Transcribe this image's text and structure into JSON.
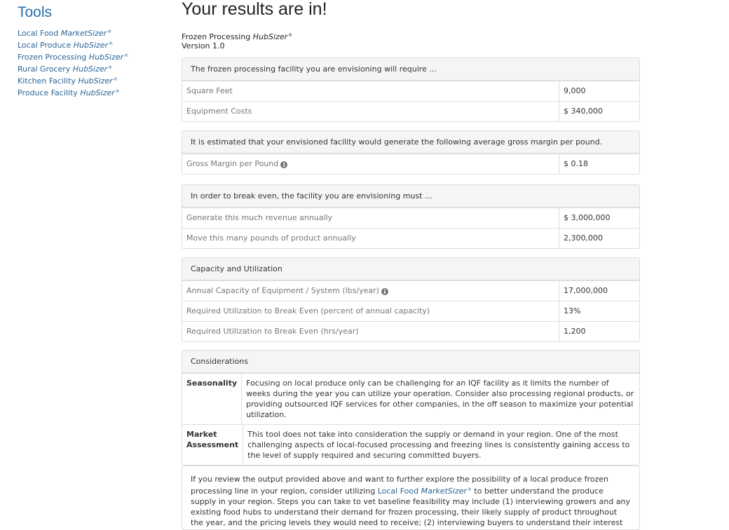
{
  "sidebar": {
    "title": "Tools",
    "links": [
      {
        "plain": "Local Food",
        "italic": "MarketSizer",
        "mark": "®"
      },
      {
        "plain": "Local Produce",
        "italic": "HubSizer",
        "mark": "®"
      },
      {
        "plain": "Frozen Processing",
        "italic": "HubSizer",
        "mark": "®"
      },
      {
        "plain": "Rural Grocery",
        "italic": "HubSizer",
        "mark": "®"
      },
      {
        "plain": "Kitchen Facility",
        "italic": "HubSizer",
        "mark": "®"
      },
      {
        "plain": "Produce Facility",
        "italic": "HubSizer",
        "mark": "®"
      }
    ]
  },
  "main": {
    "title": "Your results are in!",
    "product_plain": "Frozen Processing",
    "product_italic": "HubSizer",
    "product_mark": "®",
    "version": "Version 1.0",
    "requirements": {
      "heading": "The frozen processing facility you are envisioning will require ...",
      "rows": [
        {
          "label": "Square Feet",
          "value": "9,000"
        },
        {
          "label": "Equipment Costs",
          "value": "$ 340,000"
        }
      ]
    },
    "margin": {
      "heading": "It is estimated that your envisioned facility would generate the following average gross margin per pound.",
      "rows": [
        {
          "label": "Gross Margin per Pound",
          "value": "$ 0.18"
        }
      ]
    },
    "breakeven": {
      "heading": "In order to break even, the facility you are envisioning must ...",
      "rows": [
        {
          "label": "Generate this much revenue annually",
          "value": "$ 3,000,000"
        },
        {
          "label": "Move this many pounds of product annually",
          "value": "2,300,000"
        }
      ]
    },
    "capacity": {
      "heading": "Capacity and Utilization",
      "rows": [
        {
          "label": "Annual Capacity of Equipment / System (lbs/year)",
          "value": "17,000,000"
        },
        {
          "label": "Required Utilization to Break Even (percent of annual capacity)",
          "value": "13%"
        },
        {
          "label": "Required Utilization to Break Even (hrs/year)",
          "value": "1,200"
        }
      ]
    },
    "considerations": {
      "heading": "Considerations",
      "rows": [
        {
          "term": "Seasonality",
          "desc": "Focusing on local produce only can be challenging for an IQF facility as it limits the number of weeks during the year you can utilize your operation. Consider also processing regional products, or providing outsourced IQF services for other companies, in the off season to maximize your potential utilization."
        },
        {
          "term": "Market Assessment",
          "desc": "This tool does not take into consideration the supply or demand in your region. One of the most challenging aspects of local-focused processing and freezing lines is consistently gaining access to the level of supply required and securing committed buyers."
        }
      ]
    },
    "final": {
      "text_before": "If you review the output provided above and want to further explore the possibility of a local produce frozen processing line in your region, consider utilizing ",
      "link_plain": "Local Food",
      "link_italic": "MarketSizer",
      "link_mark": "®",
      "text_after": " to better understand the produce supply in your region. Steps you can take to vet baseline feasibility may include (1) interviewing growers and any existing food hubs to understand their demand for frozen processing, their likely supply of product throughout the year, and the pricing levels they would need to receive; (2) interviewing buyers to understand their interest in frozen local, the types of products they would prefer and their"
    }
  },
  "colors": {
    "link": "#2a6496",
    "sidebar_title": "#2a6fad",
    "panel_heading_bg": "#f5f5f5",
    "border": "#dddddd"
  },
  "icons": {
    "info": "info-circle-icon"
  }
}
